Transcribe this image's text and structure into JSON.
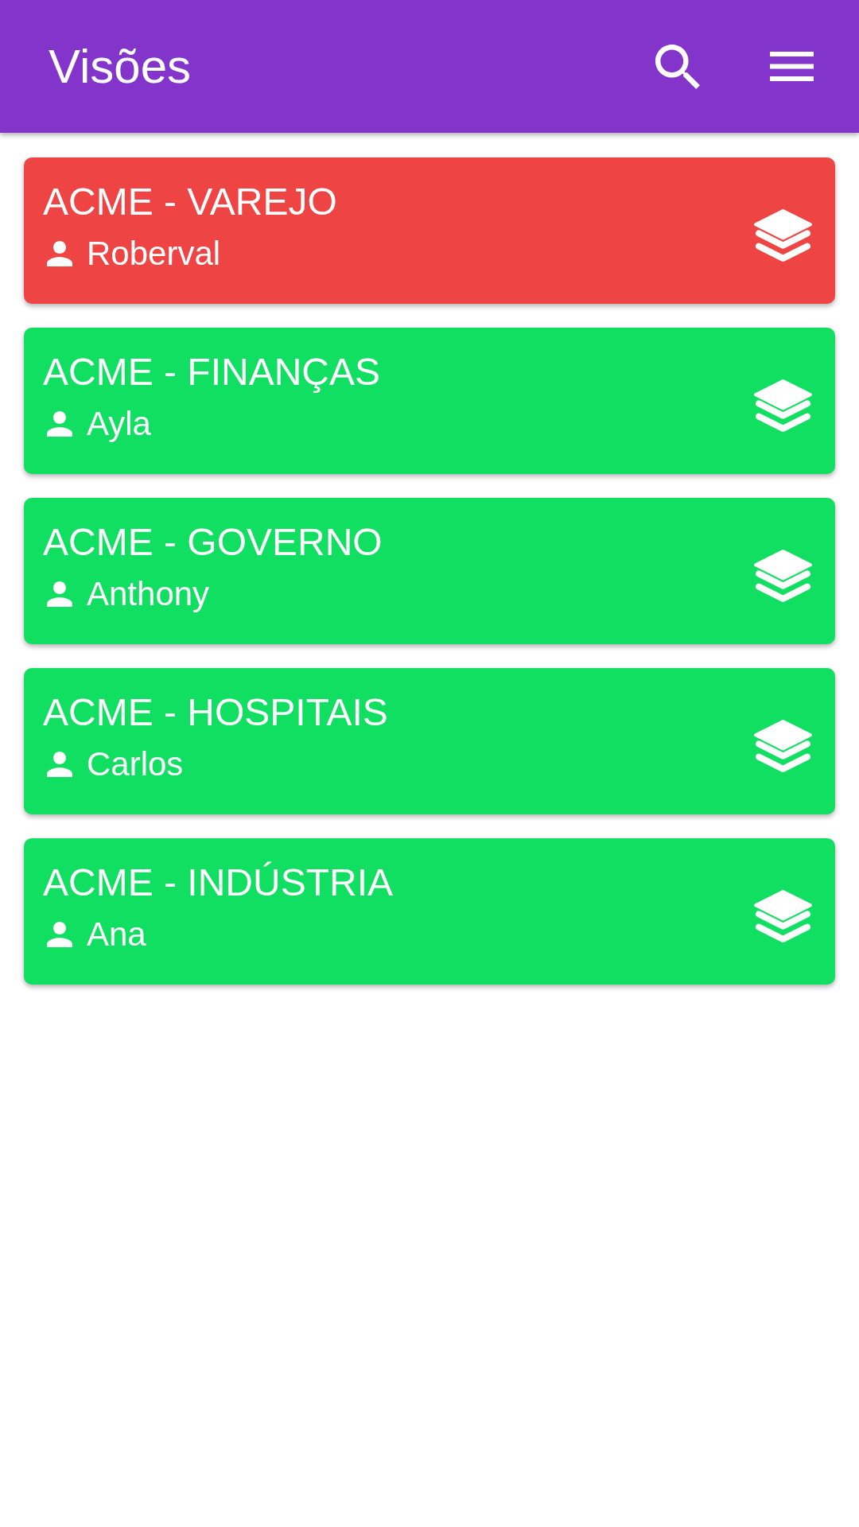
{
  "app_bar": {
    "title": "Visões"
  },
  "cards": [
    {
      "title": "ACME - VAREJO",
      "owner": "Roberval",
      "color": "#ef4444"
    },
    {
      "title": "ACME - FINANÇAS",
      "owner": "Ayla",
      "color": "#11df61"
    },
    {
      "title": "ACME - GOVERNO",
      "owner": "Anthony",
      "color": "#11df61"
    },
    {
      "title": "ACME - HOSPITAIS",
      "owner": "Carlos",
      "color": "#11df61"
    },
    {
      "title": "ACME - INDÚSTRIA",
      "owner": "Ana",
      "color": "#11df61"
    }
  ]
}
